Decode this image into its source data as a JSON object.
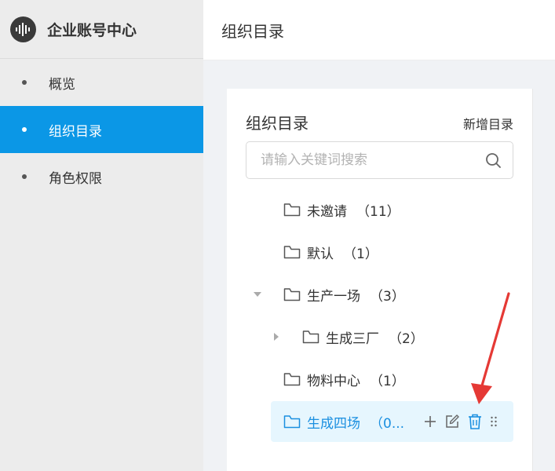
{
  "brand": {
    "title": "企业账号中心"
  },
  "nav": [
    {
      "label": "概览",
      "active": false
    },
    {
      "label": "组织目录",
      "active": true
    },
    {
      "label": "角色权限",
      "active": false
    }
  ],
  "header": {
    "title": "组织目录"
  },
  "panel": {
    "title": "组织目录",
    "add_label": "新增目录",
    "search": {
      "placeholder": "请输入关键词搜索",
      "value": ""
    }
  },
  "tree": [
    {
      "label": "未邀请",
      "count": "（11）"
    },
    {
      "label": "默认",
      "count": "（1）"
    },
    {
      "label": "生产一场",
      "count": "（3）",
      "expanded": true
    },
    {
      "label": "生成三厂",
      "count": "（2）",
      "collapsed": true
    },
    {
      "label": "物料中心",
      "count": "（1）"
    },
    {
      "label": "生成四场",
      "count": "（0...",
      "selected": true
    }
  ],
  "colors": {
    "accent": "#0b97e6",
    "selected_bg": "#e6f6fe",
    "annotation": "#e53935"
  },
  "icons": [
    "audio-wave-logo-icon",
    "search-icon",
    "folder-icon",
    "caret-down-icon",
    "caret-right-icon",
    "plus-icon",
    "edit-icon",
    "trash-icon",
    "drag-handle-icon"
  ]
}
